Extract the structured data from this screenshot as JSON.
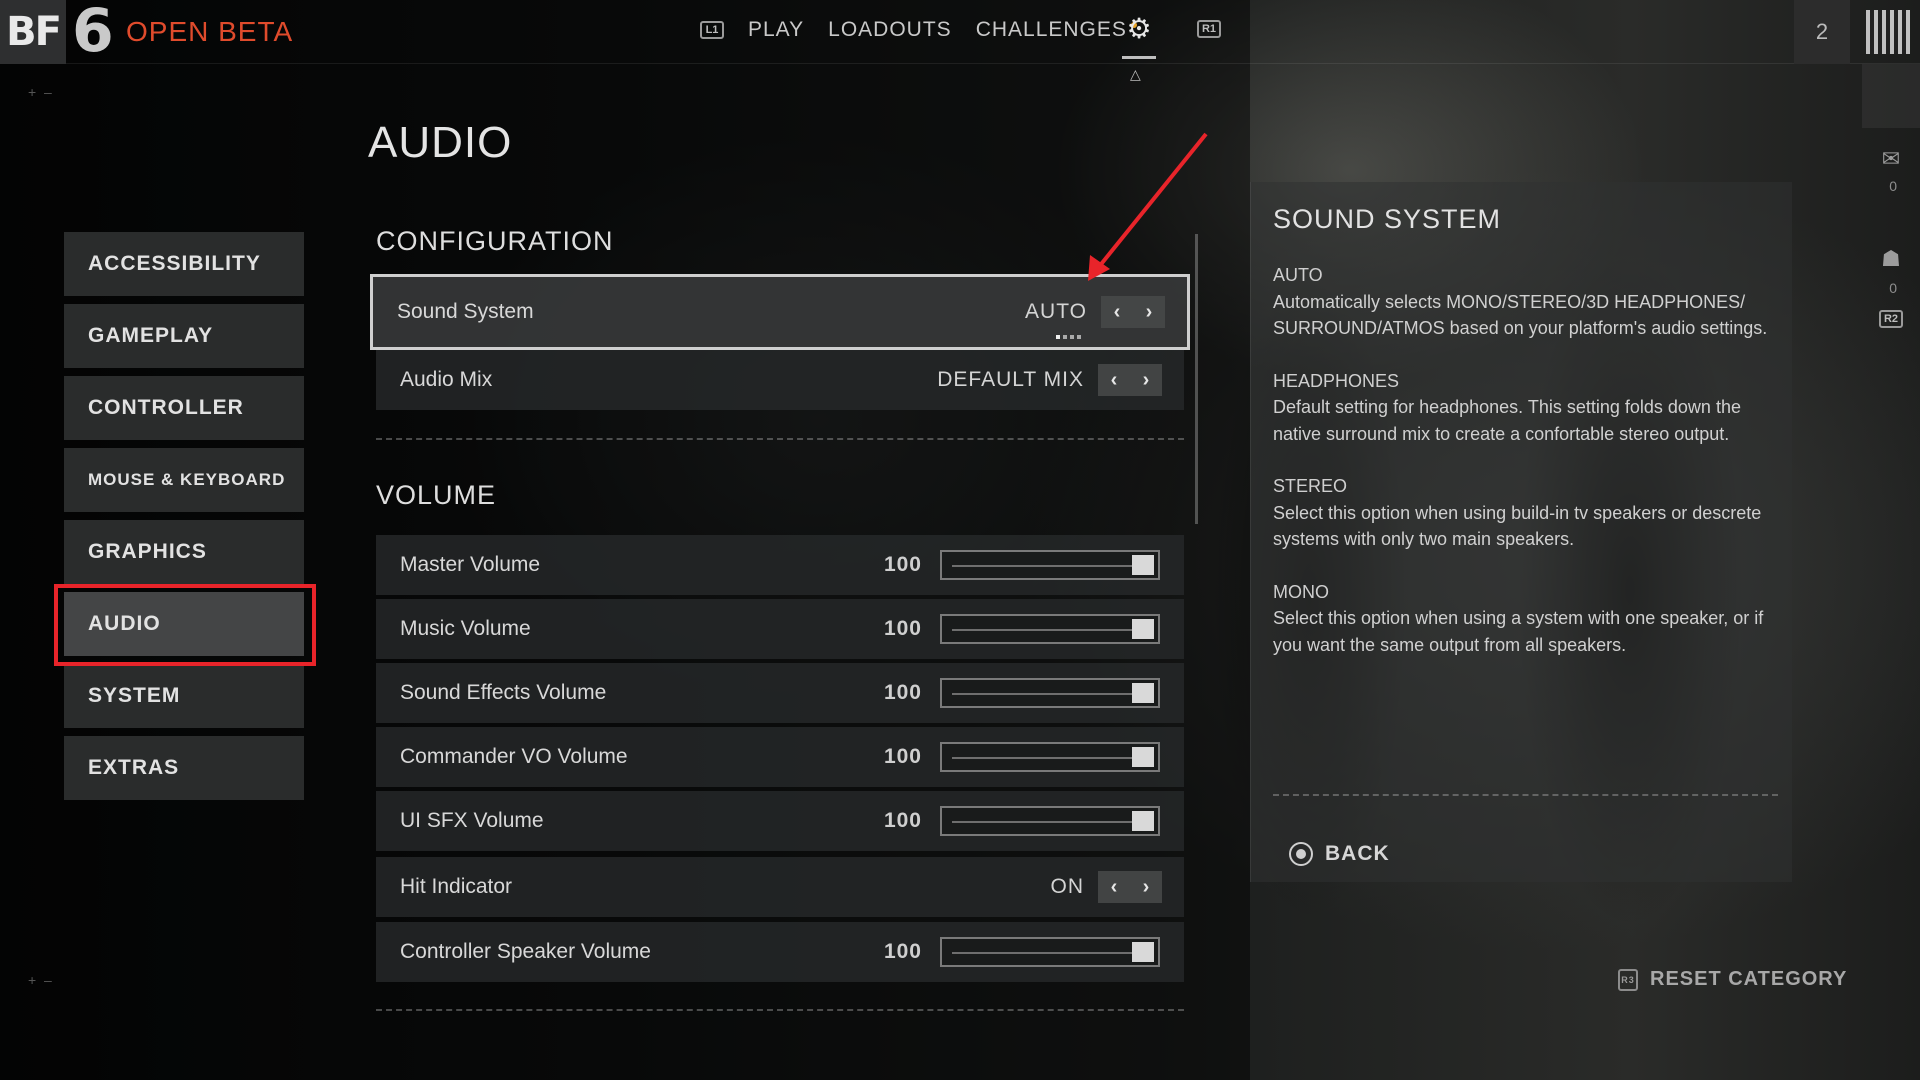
{
  "brand": {
    "logo_text": "BF",
    "logo_number": "6",
    "tag": "OPEN BETA"
  },
  "topnav": {
    "left_button": "L1",
    "items": [
      {
        "label": "PLAY"
      },
      {
        "label": "LOADOUTS"
      },
      {
        "label": "CHALLENGES",
        "has_dot": true
      }
    ],
    "settings_icon": "gear-icon",
    "right_button": "R1",
    "player_count": "2"
  },
  "page_title": "AUDIO",
  "sidebar": {
    "items": [
      {
        "label": "ACCESSIBILITY"
      },
      {
        "label": "GAMEPLAY"
      },
      {
        "label": "CONTROLLER"
      },
      {
        "label": "MOUSE & KEYBOARD"
      },
      {
        "label": "GRAPHICS"
      },
      {
        "label": "AUDIO",
        "active": true
      },
      {
        "label": "SYSTEM"
      },
      {
        "label": "EXTRAS"
      }
    ]
  },
  "configuration": {
    "title": "CONFIGURATION",
    "rows": [
      {
        "label": "Sound System",
        "value": "AUTO",
        "focused": true
      },
      {
        "label": "Audio Mix",
        "value": "DEFAULT MIX"
      }
    ]
  },
  "volume": {
    "title": "VOLUME",
    "rows": [
      {
        "label": "Master Volume",
        "value": "100",
        "level": 1.0
      },
      {
        "label": "Music Volume",
        "value": "100",
        "level": 1.0
      },
      {
        "label": "Sound Effects Volume",
        "value": "100",
        "level": 1.0
      },
      {
        "label": "Commander VO Volume",
        "value": "100",
        "level": 1.0
      },
      {
        "label": "UI SFX Volume",
        "value": "100",
        "level": 1.0
      },
      {
        "label": "Hit Indicator",
        "value": "ON"
      },
      {
        "label": "Controller Speaker Volume",
        "value": "100",
        "level": 1.0
      }
    ]
  },
  "info_panel": {
    "title": "SOUND SYSTEM",
    "sections": [
      {
        "heading": "AUTO",
        "text": "Automatically selects MONO/STEREO/3D HEADPHONES/ SURROUND/ATMOS based on your platform's audio settings."
      },
      {
        "heading": "HEADPHONES",
        "text": "Default setting for headphones. This setting folds down the native surround mix to create a confortable stereo output."
      },
      {
        "heading": "STEREO",
        "text": "Select this option when using build-in tv speakers or descrete systems with only two main speakers."
      },
      {
        "heading": "MONO",
        "text": "Select this option when using a system with one speaker, or if you want the same output from all speakers."
      }
    ],
    "back_label": "BACK"
  },
  "right_rail": {
    "mail_count": "0",
    "friends_count": "0",
    "button": "R2"
  },
  "reset_label": "RESET CATEGORY",
  "reset_button": "R3",
  "annotation_color": "#e8242a",
  "accent_color": "#e04b2c"
}
